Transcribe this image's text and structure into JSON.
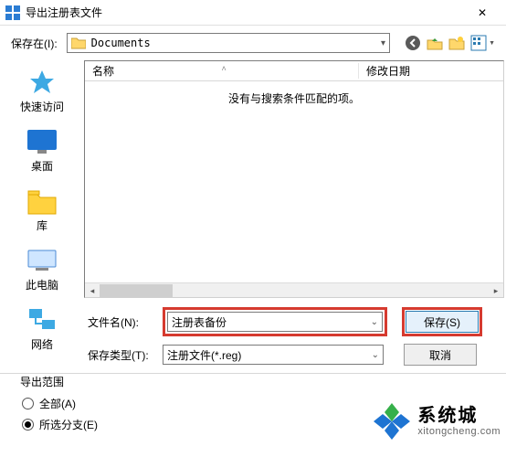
{
  "window": {
    "title": "导出注册表文件",
    "close_glyph": "✕"
  },
  "toolbar": {
    "save_in_label": "保存在(I):",
    "location": "Documents",
    "icons": {
      "back": "back-icon",
      "up": "up-one-level-icon",
      "newfolder": "new-folder-icon",
      "views": "views-icon"
    }
  },
  "places": [
    {
      "label": "快速访问"
    },
    {
      "label": "桌面"
    },
    {
      "label": "库"
    },
    {
      "label": "此电脑"
    },
    {
      "label": "网络"
    }
  ],
  "list": {
    "col_name": "名称",
    "col_date": "修改日期",
    "empty": "没有与搜索条件匹配的项。"
  },
  "filename": {
    "label": "文件名(N):",
    "value": "注册表备份"
  },
  "filetype": {
    "label": "保存类型(T):",
    "value": "注册文件(*.reg)"
  },
  "buttons": {
    "save": "保存(S)",
    "cancel": "取消"
  },
  "scope": {
    "title": "导出范围",
    "all": "全部(A)",
    "selected": "所选分支(E)"
  },
  "watermark": {
    "cn": "系统城",
    "url": "xitongcheng.com"
  }
}
